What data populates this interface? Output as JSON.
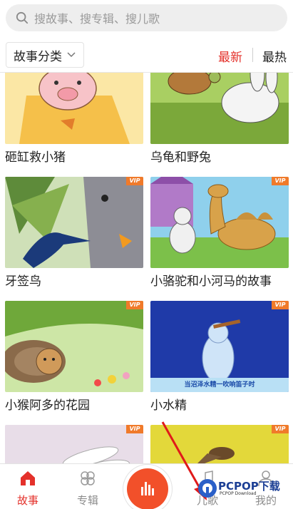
{
  "search": {
    "placeholder": "搜故事、搜专辑、搜儿歌",
    "icon": "search-icon"
  },
  "filter": {
    "category_label": "故事分类",
    "sort_newest": "最新",
    "sort_hottest": "最热",
    "active_color": "#e4312b"
  },
  "stories": [
    {
      "title": "砸缸救小猪",
      "vip": false
    },
    {
      "title": "乌龟和野兔",
      "vip": false
    },
    {
      "title": "牙签鸟",
      "vip": true,
      "vip_label": "VIP"
    },
    {
      "title": "小骆驼和小河马的故事",
      "vip": true,
      "vip_label": "VIP"
    },
    {
      "title": "小猴阿多的花园",
      "vip": true,
      "vip_label": "VIP"
    },
    {
      "title": "小水精",
      "vip": true,
      "vip_label": "VIP",
      "caption": "当沼泽水精一吹响笛子时"
    },
    {
      "title": "",
      "vip": true,
      "vip_label": "VIP"
    },
    {
      "title": "",
      "vip": true,
      "vip_label": "VIP"
    }
  ],
  "nav": {
    "story": "故事",
    "album": "专辑",
    "song": "儿歌",
    "mine": "我的"
  },
  "watermark": {
    "brand": "PCPOP下载",
    "sub": "PCPOP Download"
  }
}
